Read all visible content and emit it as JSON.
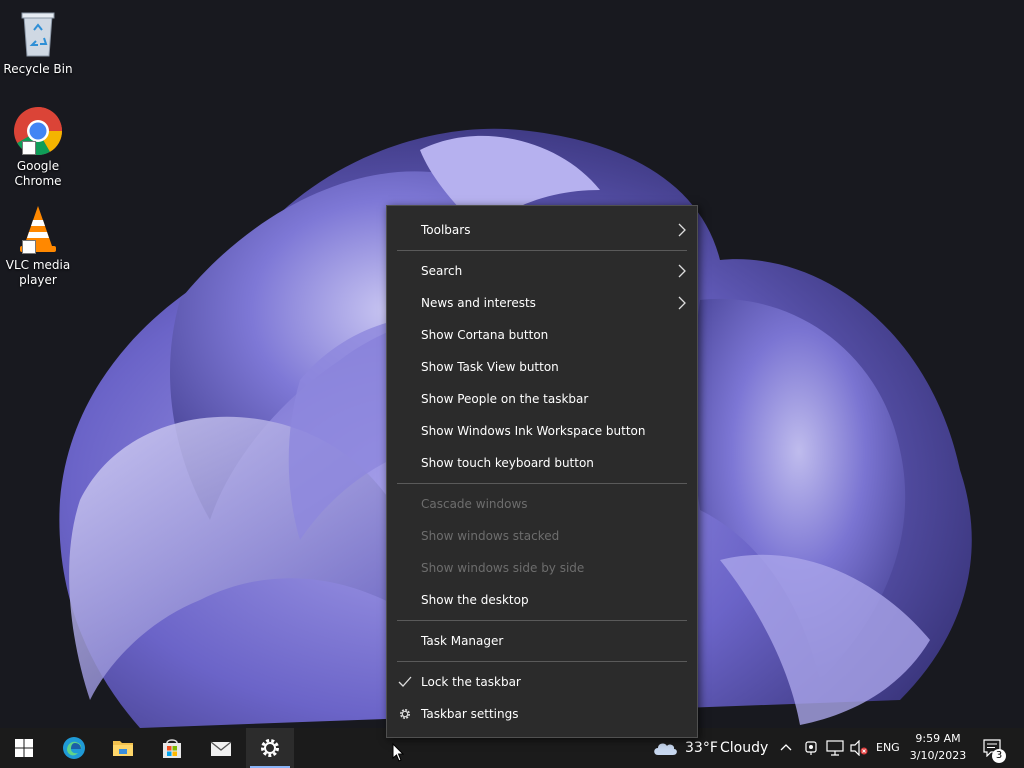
{
  "desktop": {
    "icons": [
      {
        "label": "Recycle Bin",
        "icon": "recycle-bin-icon"
      },
      {
        "label": "Google Chrome",
        "icon": "chrome-icon"
      },
      {
        "label": "VLC media player",
        "icon": "vlc-icon"
      }
    ]
  },
  "context_menu": {
    "toolbars": "Toolbars",
    "search": "Search",
    "news_and_interests": "News and interests",
    "show_cortana": "Show Cortana button",
    "show_task_view": "Show Task View button",
    "show_people": "Show People on the taskbar",
    "show_ink_workspace": "Show Windows Ink Workspace button",
    "show_touch_keyboard": "Show touch keyboard button",
    "cascade_windows": "Cascade windows",
    "show_stacked": "Show windows stacked",
    "show_side_by_side": "Show windows side by side",
    "show_desktop": "Show the desktop",
    "task_manager": "Task Manager",
    "lock_taskbar": "Lock the taskbar",
    "taskbar_settings": "Taskbar settings"
  },
  "taskbar": {
    "pinned": [
      "start-icon",
      "edge-icon",
      "file-explorer-icon",
      "store-icon",
      "mail-icon",
      "settings-icon"
    ],
    "weather": {
      "temperature": "33°F",
      "condition": "Cloudy"
    },
    "language": "ENG",
    "time": "9:59 AM",
    "date": "3/10/2023",
    "notification_count": "3"
  }
}
